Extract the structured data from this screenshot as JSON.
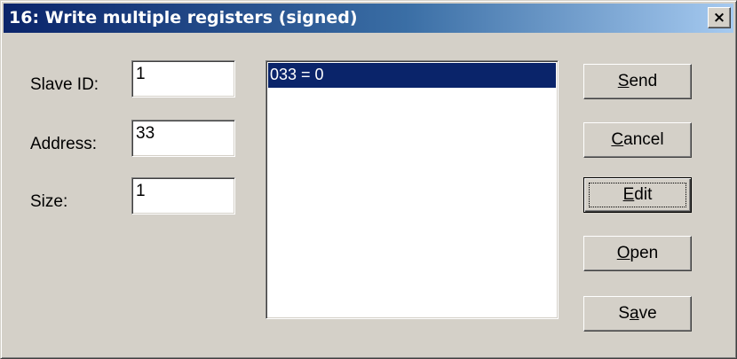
{
  "window": {
    "title": "16: Write multiple registers (signed)",
    "close_glyph": "×"
  },
  "form": {
    "slave_id_label": "Slave ID:",
    "slave_id_value": "1",
    "address_label": "Address:",
    "address_value": "33",
    "size_label": "Size:",
    "size_value": "1"
  },
  "registers": {
    "items": [
      {
        "text": "033 = 0",
        "selected": true
      }
    ]
  },
  "buttons": {
    "send": {
      "pre": "",
      "mnemonic": "S",
      "post": "end"
    },
    "cancel": {
      "pre": "",
      "mnemonic": "C",
      "post": "ancel"
    },
    "edit": {
      "pre": "",
      "mnemonic": "E",
      "post": "dit"
    },
    "open": {
      "pre": "",
      "mnemonic": "O",
      "post": "pen"
    },
    "save": {
      "pre": "S",
      "mnemonic": "a",
      "post": "ve"
    }
  },
  "colors": {
    "title_gradient_start": "#0a246a",
    "title_gradient_end": "#a6caf0",
    "selection": "#0a246a",
    "face": "#d4d0c8"
  }
}
